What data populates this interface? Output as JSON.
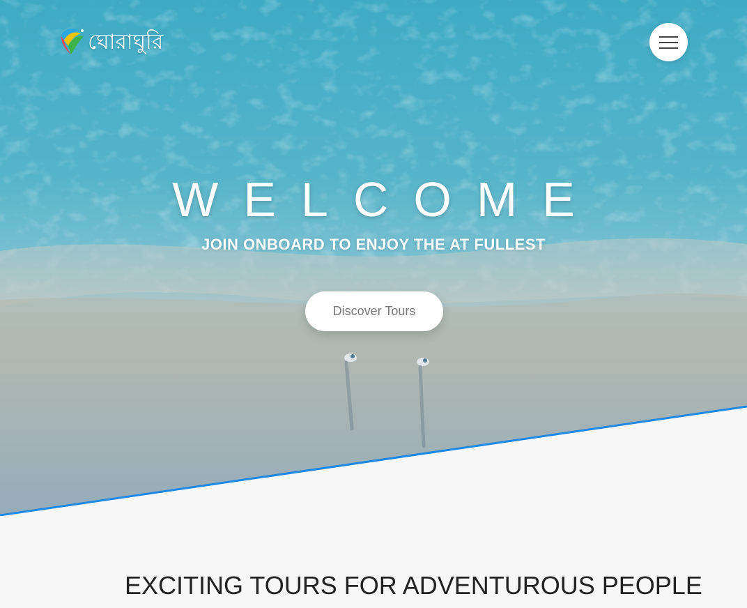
{
  "header": {
    "logo_text": "ঘোরাঘুরি",
    "menu_icon": "hamburger-menu-icon"
  },
  "hero": {
    "title": "WELCOME",
    "subtitle": "JOIN ONBOARD TO ENJOY THE AT FULLEST",
    "cta_label": "Discover Tours"
  },
  "section": {
    "heading": "EXCITING TOURS FOR ADVENTUROUS PEOPLE"
  },
  "colors": {
    "accent_line": "#1e88e5",
    "page_background": "#f7f7f7",
    "overlay_tint": "#4fb3d6"
  }
}
